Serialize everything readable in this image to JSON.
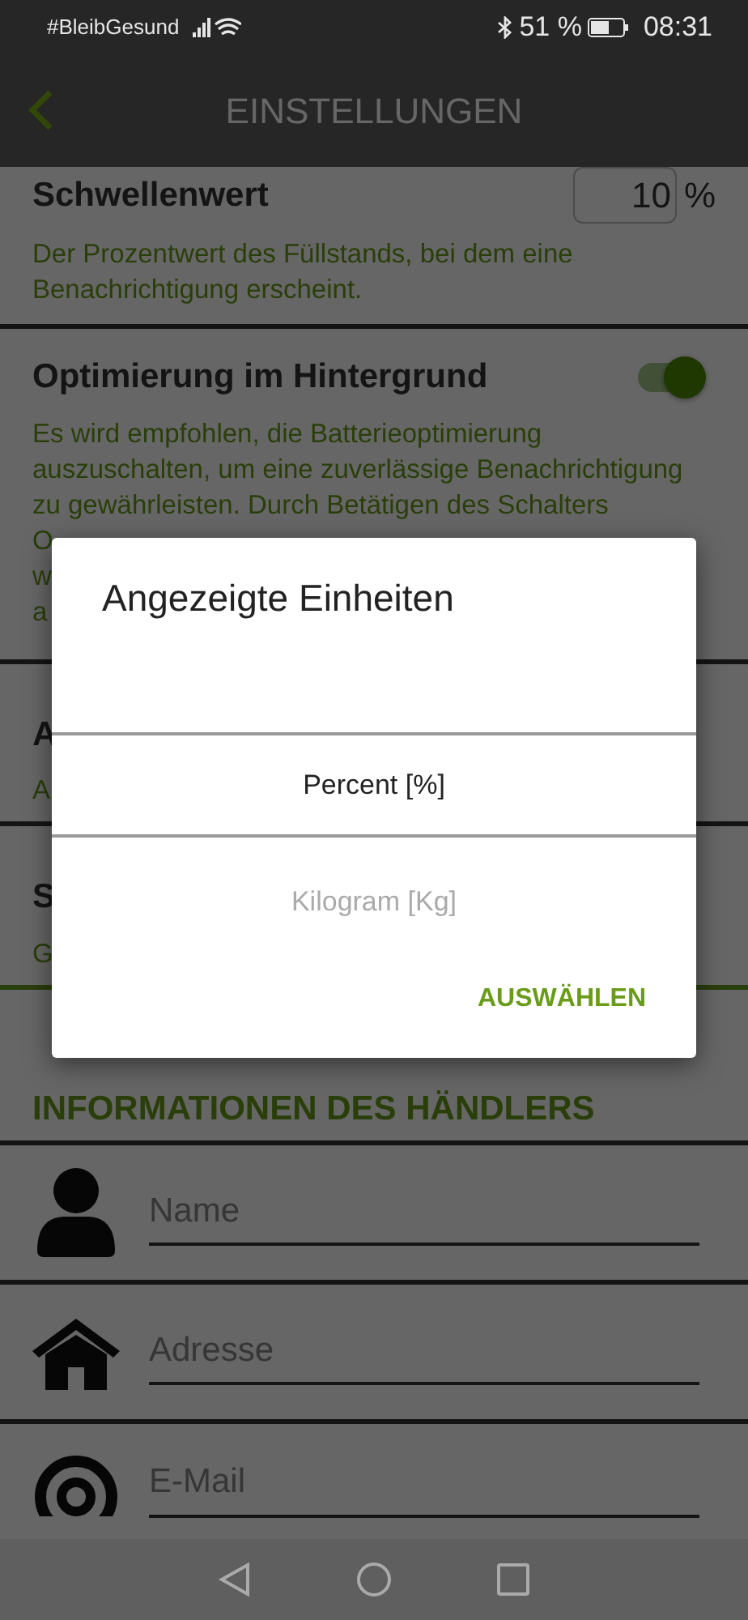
{
  "status_bar": {
    "carrier": "#BleibGesund",
    "battery": "51 %",
    "time": "08:31"
  },
  "app_bar": {
    "title": "EINSTELLUNGEN"
  },
  "settings": [
    {
      "kind": "number",
      "title": "Schwellenwert",
      "value": "10",
      "unit": "%",
      "description": [
        "Der Prozentwert des Füllstands, bei dem eine",
        "Benachrichtigung erscheint."
      ]
    },
    {
      "kind": "switch",
      "title": "Optimierung im Hintergrund",
      "on": true,
      "description": [
        "Es wird empfohlen, die Batterieoptimierung",
        "auszuschalten, um eine zuverlässige Benachrichtigung",
        "zu gewährleisten. Durch Betätigen des Schalters",
        "O",
        "w",
        "a"
      ]
    },
    {
      "kind": "field",
      "title": "A",
      "description": [
        "A"
      ]
    },
    {
      "kind": "field",
      "title": "S",
      "description": [
        "G"
      ]
    }
  ],
  "merchant": {
    "heading": "INFORMATIONEN DES HÄNDLERS",
    "fields": [
      {
        "kind": "person",
        "placeholder": "Name"
      },
      {
        "kind": "home",
        "placeholder": "Adresse"
      },
      {
        "kind": "email",
        "placeholder": "E-Mail"
      }
    ]
  },
  "dialog": {
    "title": "Angezeigte Einheiten",
    "options": [
      {
        "label": "Percent [%]",
        "selected": true
      },
      {
        "label": "Kilogram [Kg]",
        "selected": false
      }
    ],
    "button": "AUSWÄHLEN"
  }
}
